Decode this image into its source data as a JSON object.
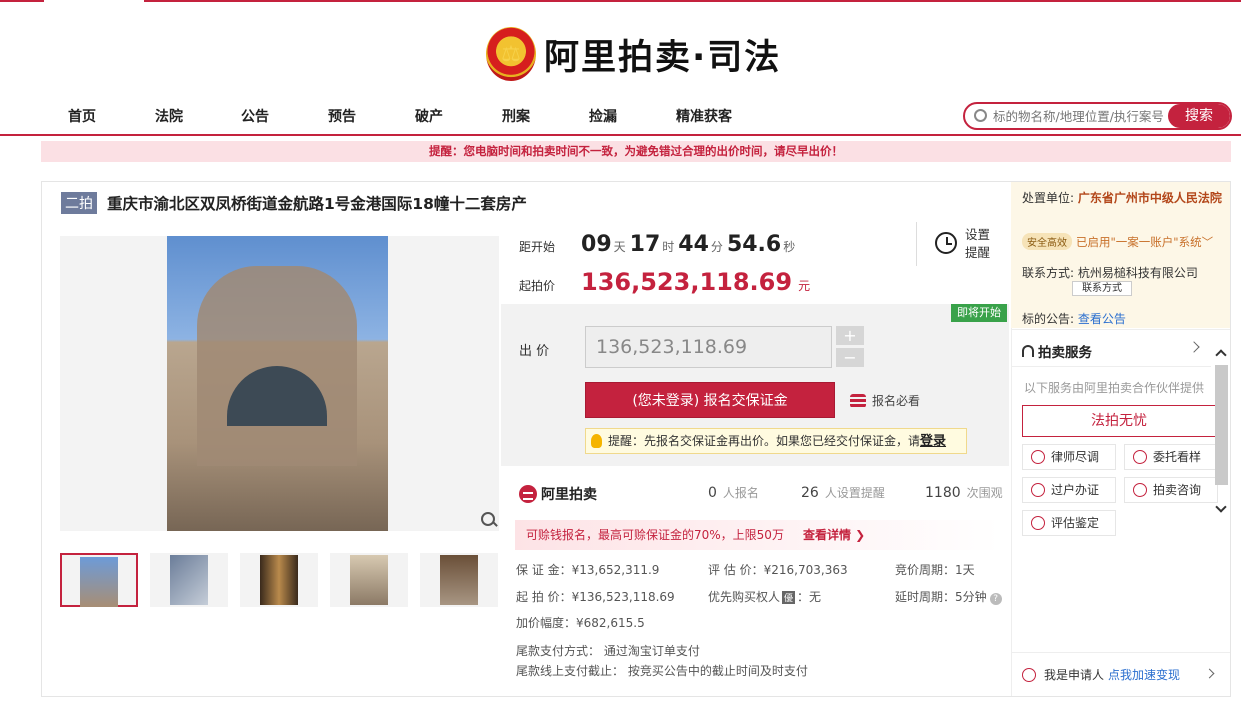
{
  "brand": {
    "title": "阿里拍卖·司法"
  },
  "nav": {
    "items": [
      "首页",
      "法院",
      "公告",
      "预告",
      "破产",
      "刑案",
      "捡漏",
      "精准获客"
    ]
  },
  "search": {
    "placeholder": "标的物名称/地理位置/执行案号",
    "button": "搜索"
  },
  "alert": "提醒：您电脑时间和拍卖时间不一致，为避免错过合理的出价时间，请尽早出价！",
  "item": {
    "tag": "二拍",
    "title": "重庆市渝北区双凤桥街道金航路1号金港国际18幢十二套房产"
  },
  "countdown": {
    "label": "距开始",
    "days": "09",
    "days_unit": "天",
    "hours": "17",
    "hours_unit": "时",
    "minutes": "44",
    "minutes_unit": "分",
    "seconds": "54.6",
    "seconds_unit": "秒"
  },
  "remind": {
    "label": "设置提醒"
  },
  "start_price": {
    "label": "起拍价",
    "value": "136,523,118.69",
    "unit": "元"
  },
  "status_badge": "即将开始",
  "bid": {
    "label": "出 价",
    "value": "136,523,118.69",
    "plus": "+",
    "minus": "−",
    "signup": "(您未登录) 报名交保证金",
    "must_read": "报名必看",
    "hint": "提醒：先报名交保证金再出价。如果您已经交付保证金，请",
    "hint_login": "登录"
  },
  "stats": {
    "brand": "阿里拍卖",
    "signups": "0",
    "signups_label": "人报名",
    "reminders": "26",
    "reminders_label": "人设置提醒",
    "views": "1180",
    "views_label": "次围观"
  },
  "promo": {
    "text": "可赊钱报名，最高可赊保证金的70%，上限50万",
    "more": "查看详情 ❯"
  },
  "details": {
    "deposit": "保 证 金：¥13,652,311.9",
    "start": "起 拍 价：¥136,523,118.69",
    "increment": "加价幅度：¥682,615.5",
    "appraisal": "评 估 价：¥216,703,363",
    "priority_label": "优先购买权人",
    "priority_badge": "優",
    "priority_value": "：无",
    "cycle": "竞价周期：1天",
    "delay": "延时周期：5分钟",
    "payment_method": "尾款支付方式：   通过淘宝订单支付",
    "payment_deadline": "尾款线上支付截止：   按竞买公告中的截止时间及时支付"
  },
  "side": {
    "court_label": "处置单位:",
    "court_value": "广东省广州市中级人民法院",
    "safe_badge": "安全高效",
    "safe_text": "已启用\"一案一账户\"系统",
    "contact_label": "联系方式:",
    "contact_value": "杭州易槌科技有限公司",
    "contact_button": "联系方式",
    "notice_label": "标的公告:",
    "notice_link": "查看公告",
    "services_title": "拍卖服务",
    "services_sub": "以下服务由阿里拍卖合作伙伴提供",
    "fapai": "法拍无忧",
    "services": [
      "律师尽调",
      "委托看样",
      "过户办证",
      "拍卖咨询",
      "评估鉴定"
    ],
    "applicant_label": "我是申请人",
    "applicant_link": "点我加速变现"
  },
  "colors": {
    "accent": "#c4223e",
    "safe": "#c8702a",
    "link": "#2b6fcf",
    "badge_green": "#39a24a"
  }
}
